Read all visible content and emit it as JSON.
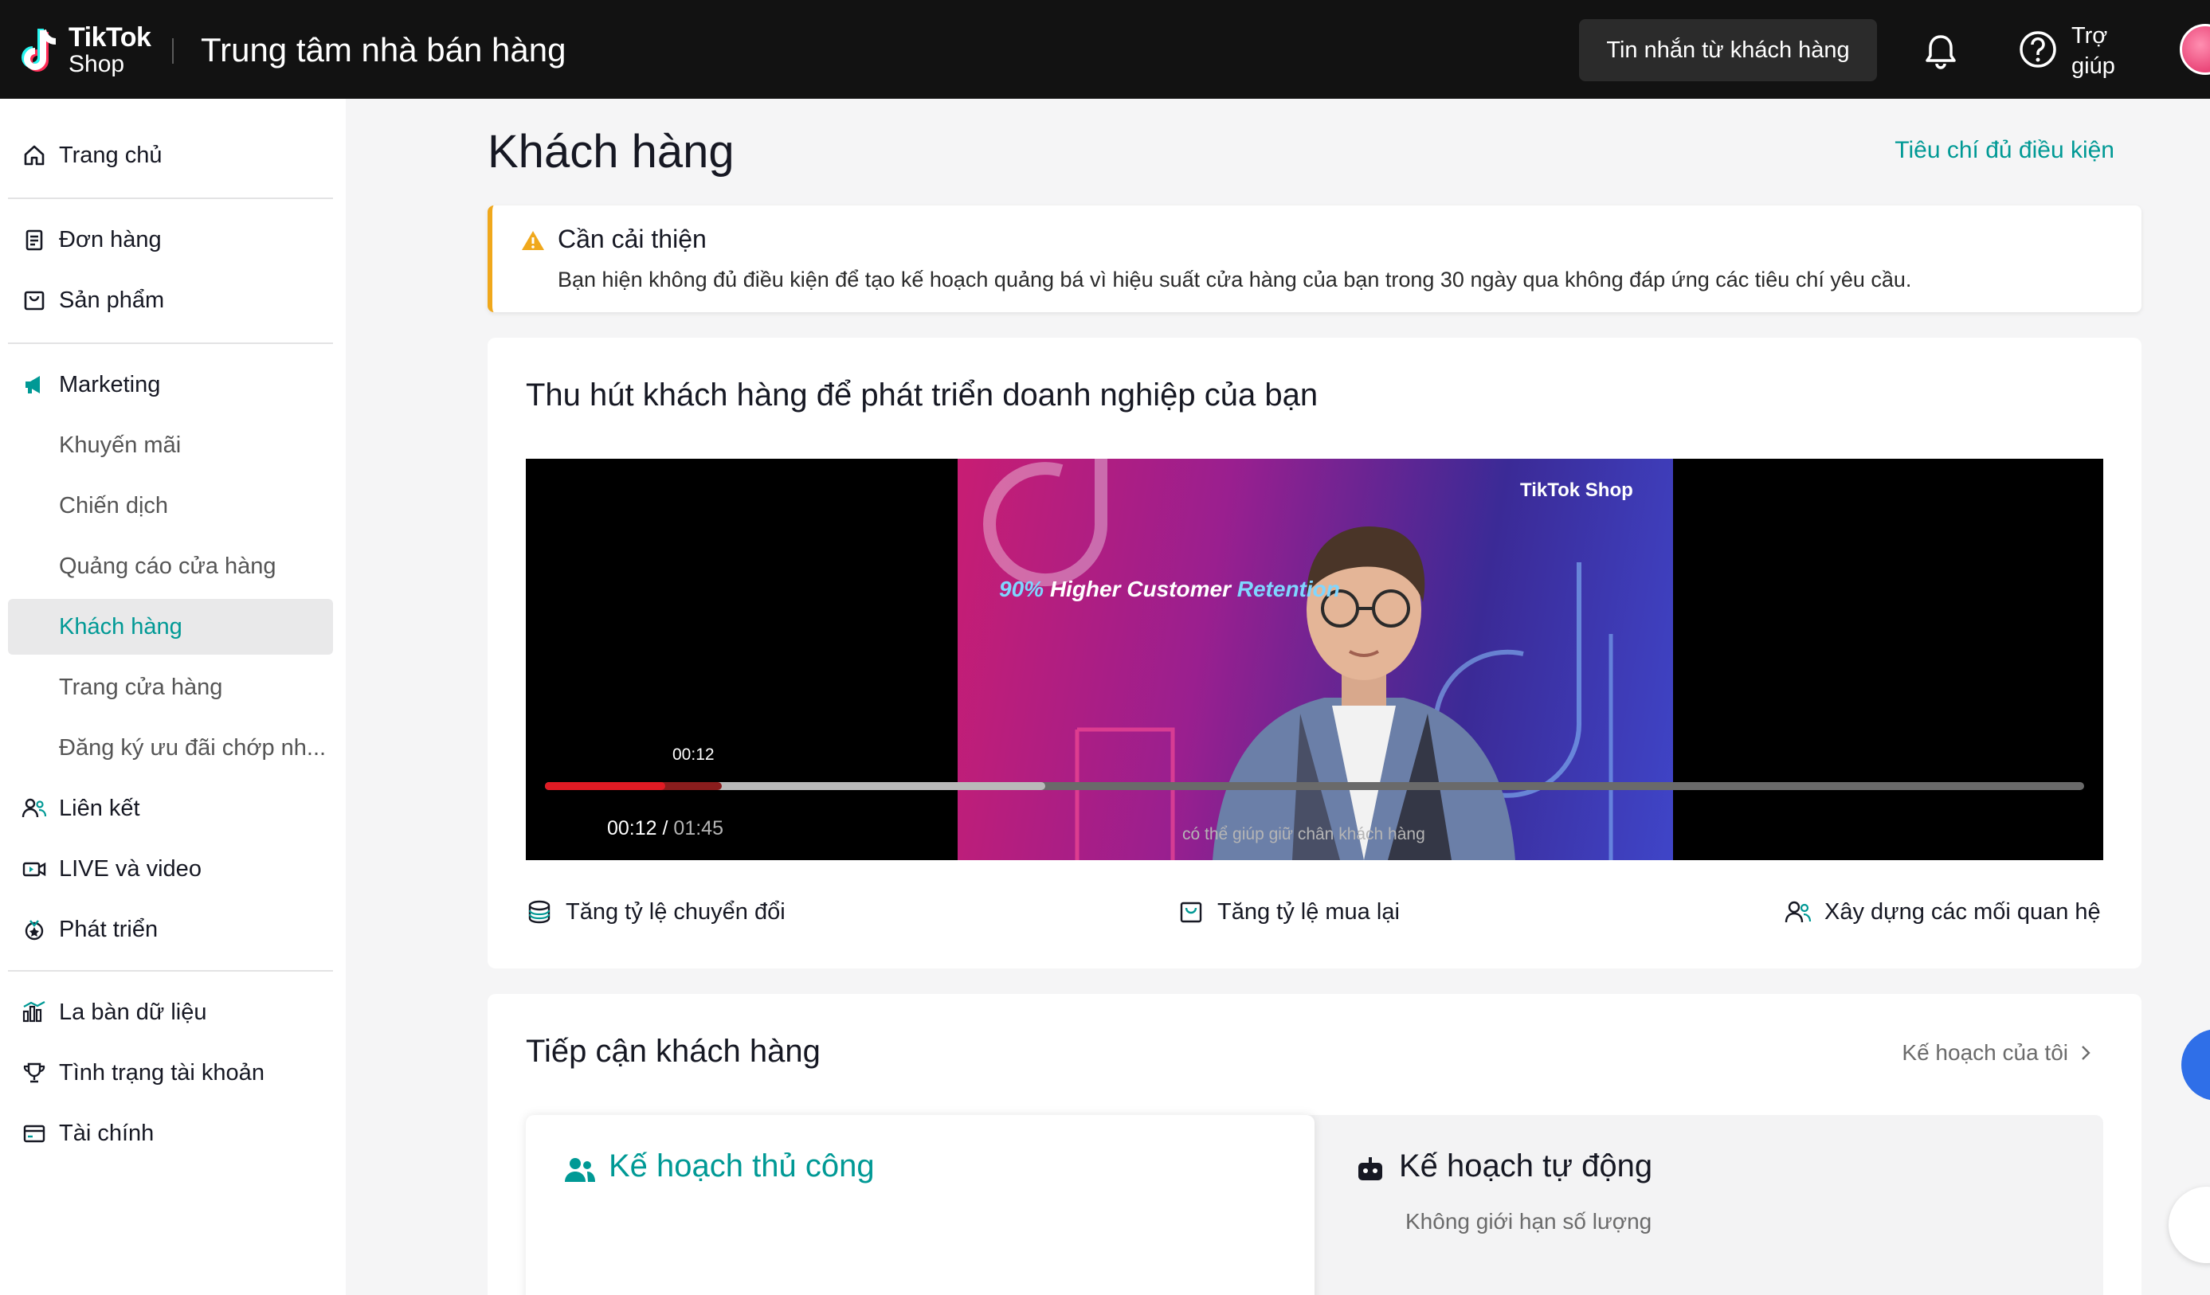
{
  "topbar": {
    "logo_line1": "TikTok",
    "logo_line2": "Shop",
    "app_title": "Trung tâm nhà bán hàng",
    "messages_button": "Tin nhắn từ khách hàng",
    "help_label": "Trợ giúp"
  },
  "sidebar": {
    "items": [
      {
        "label": "Trang chủ",
        "icon": "home-icon"
      },
      {
        "label": "Đơn hàng",
        "icon": "orders-icon"
      },
      {
        "label": "Sản phẩm",
        "icon": "products-icon"
      },
      {
        "label": "Marketing",
        "icon": "megaphone-icon"
      },
      {
        "label": "Khuyến mãi"
      },
      {
        "label": "Chiến dịch"
      },
      {
        "label": "Quảng cáo cửa hàng"
      },
      {
        "label": "Khách hàng",
        "active": true
      },
      {
        "label": "Trang cửa hàng"
      },
      {
        "label": "Đăng ký ưu đãi chớp nh..."
      },
      {
        "label": "Liên kết",
        "icon": "affiliate-icon"
      },
      {
        "label": "LIVE và video",
        "icon": "live-video-icon"
      },
      {
        "label": "Phát triển",
        "icon": "growth-icon"
      },
      {
        "label": "La bàn dữ liệu",
        "icon": "data-compass-icon"
      },
      {
        "label": "Tình trạng tài khoản",
        "icon": "trophy-icon"
      },
      {
        "label": "Tài chính",
        "icon": "finance-icon"
      }
    ]
  },
  "main": {
    "title": "Khách hàng",
    "criteria_link": "Tiêu chí đủ điều kiện",
    "alert": {
      "title": "Cần cải thiện",
      "body": "Bạn hiện không đủ điều kiện để tạo kế hoạch quảng bá vì hiệu suất cửa hàng của bạn trong 30 ngày qua không đáp ứng các tiêu chí yêu cầu."
    },
    "attract": {
      "title": "Thu hút khách hàng để phát triển doanh nghiệp của bạn",
      "video": {
        "overlay_text_1": "90%",
        "overlay_text_2": "Higher Customer",
        "overlay_text_3": "Retention",
        "brand": "TikTok Shop",
        "hover_time": "00:12",
        "current_time": "00:12",
        "separator": "/",
        "duration": "01:45",
        "played_fraction": 0.078,
        "hover_fraction": 0.115,
        "buffered_fraction": 0.325,
        "subtitle": "có thể giúp giữ chân khách hàng"
      },
      "features": [
        {
          "label": "Tăng tỷ lệ chuyển đổi",
          "icon": "coins-icon"
        },
        {
          "label": "Tăng tỷ lệ mua lại",
          "icon": "bag-icon"
        },
        {
          "label": "Xây dựng các mối quan hệ",
          "icon": "people-icon"
        }
      ]
    },
    "reach": {
      "title": "Tiếp cận khách hàng",
      "my_plans": "Kế hoạch của tôi",
      "manual_plan": "Kế hoạch thủ công",
      "auto_plan": "Kế hoạch tự động",
      "auto_plan_sub": "Không giới hạn số lượng"
    }
  },
  "colors": {
    "accent": "#009995",
    "warning": "#f0a81c",
    "progress": "#e01b24"
  }
}
